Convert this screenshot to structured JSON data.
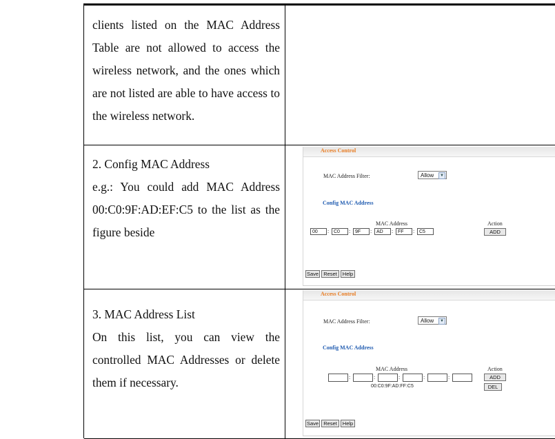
{
  "row1": {
    "lines": [
      "clients listed on the MAC Address",
      "Table are not allowed to access the",
      "wireless network, and the ones which",
      "are not listed are able to have access to",
      "the wireless network."
    ]
  },
  "row2": {
    "lines": [
      "2. Config MAC Address",
      "e.g.: You could add MAC Address",
      "00:C0:9F:AD:EF:C5 to the list as the",
      "figure beside"
    ],
    "screenshot": {
      "section_title": "Access Control",
      "filter_label": "MAC Address Filter:",
      "filter_value": "Allow",
      "config_title": "Config MAC Address",
      "mac_header": "MAC Address",
      "action_header": "Action",
      "octets": [
        "00",
        "C0",
        "9F",
        "AD",
        "FF",
        "C5"
      ],
      "add_label": "ADD",
      "save_label": "Save",
      "reset_label": "Reset",
      "help_label": "Help"
    }
  },
  "row3": {
    "lines": [
      "3. MAC Address List",
      "On this list, you can view the",
      "controlled MAC Addresses or delete",
      "them if necessary."
    ],
    "screenshot": {
      "section_title": "Access Control",
      "filter_label": "MAC Address Filter:",
      "filter_value": "Allow",
      "config_title": "Config MAC Address",
      "mac_header": "MAC Address",
      "action_header": "Action",
      "octets": [
        "",
        "",
        "",
        "",
        "",
        ""
      ],
      "listed_mac": "00:C0:9F:AD:FF:C5",
      "add_label": "ADD",
      "del_label": "DEL",
      "save_label": "Save",
      "reset_label": "Reset",
      "help_label": "Help"
    }
  }
}
